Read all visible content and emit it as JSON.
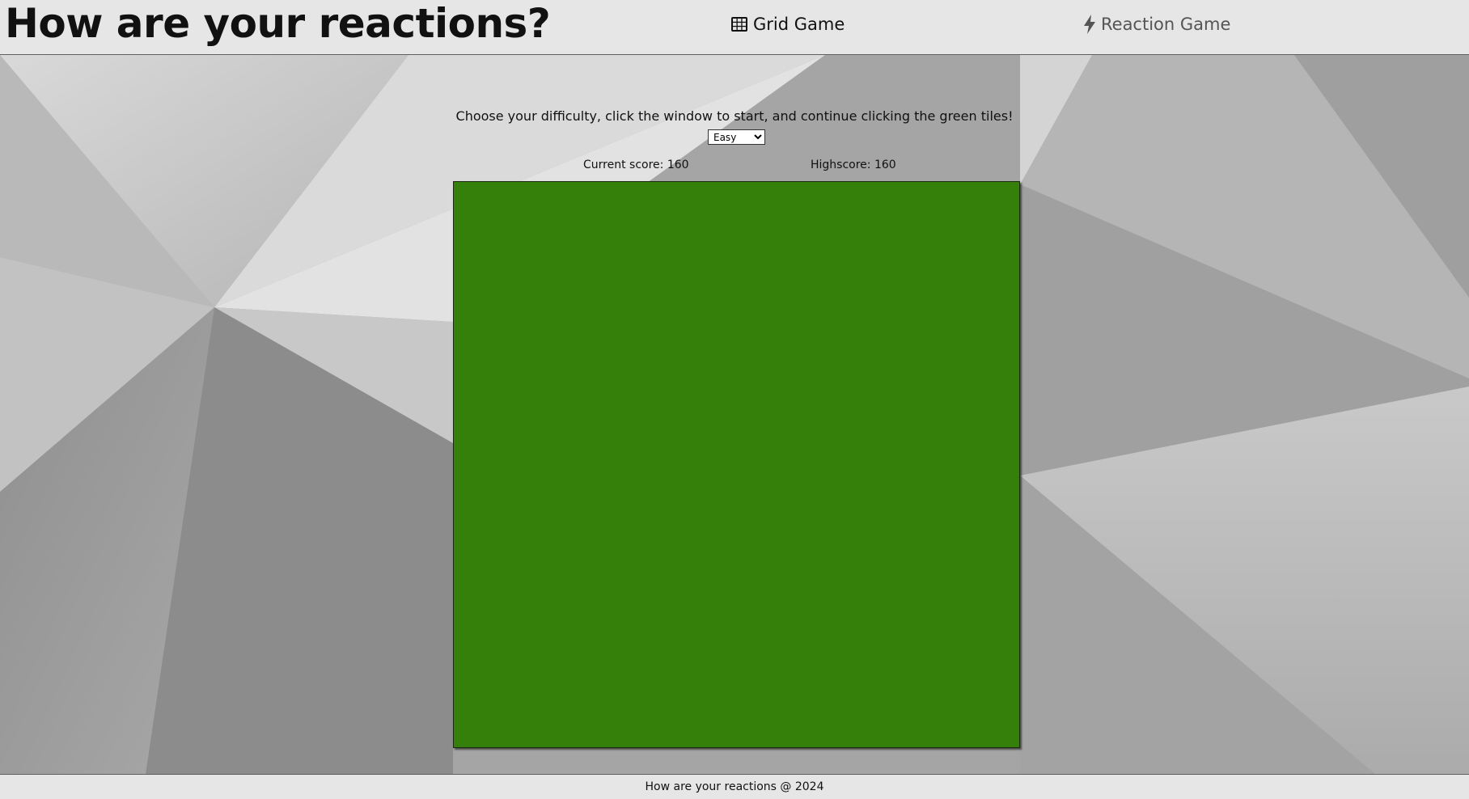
{
  "header": {
    "title": "How are your reactions?",
    "nav": [
      {
        "label": "Grid Game",
        "icon": "grid-icon"
      },
      {
        "label": "Reaction Game",
        "icon": "lightning-icon"
      }
    ]
  },
  "game": {
    "instructions": "Choose your difficulty, click the window to start, and continue clicking the green tiles!",
    "difficulty": {
      "selected": "Easy",
      "options": [
        "Easy"
      ]
    },
    "current_score_label": "Current score: 160",
    "highscore_label": "Highscore: 160",
    "tile_color": "#357f0b"
  },
  "footer": {
    "text": "How are your reactions @ 2024"
  }
}
